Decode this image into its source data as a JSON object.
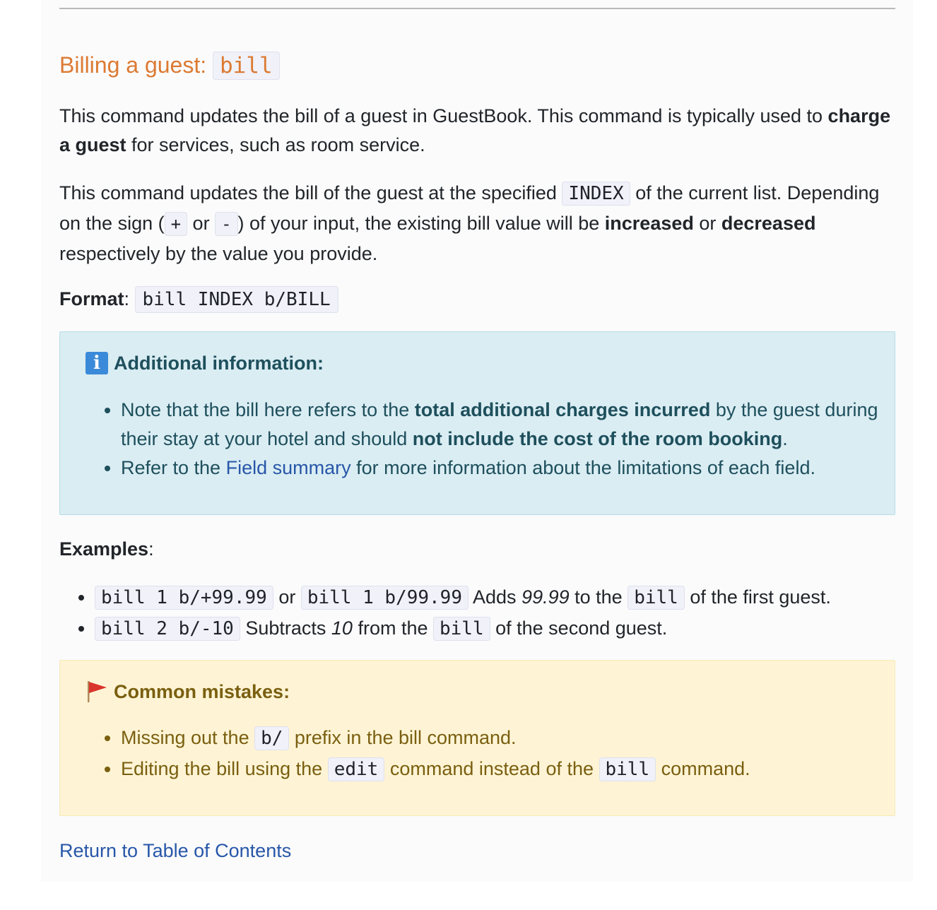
{
  "section": {
    "title_text": "Billing a guest: ",
    "title_code": "bill"
  },
  "intro": {
    "t1": "This command updates the bill of a guest in GuestBook. This command is typically used to ",
    "b1": "charge a guest",
    "t2": " for services, such as room service."
  },
  "details": {
    "t1": "This command updates the bill of the guest at the specified ",
    "c1": "INDEX",
    "t2": " of the current list. Depending on the sign (",
    "c2": "+",
    "t3": " or ",
    "c3": "-",
    "t4": ") of your input, the existing bill value will be ",
    "b1": "increased",
    "t5": " or ",
    "b2": "decreased",
    "t6": " respectively by the value you provide."
  },
  "format": {
    "label": "Format",
    "colon": ": ",
    "code": "bill INDEX b/BILL"
  },
  "info_box": {
    "icon": "info-icon",
    "title": "Additional information:",
    "item1": {
      "t1": "Note that the bill here refers to the ",
      "b1": "total additional charges incurred",
      "t2": " by the guest during their stay at your hotel and should ",
      "b2": "not include the cost of the room booking",
      "t3": "."
    },
    "item2": {
      "t1": "Refer to the ",
      "link": "Field summary",
      "t2": " for more information about the limitations of each field."
    }
  },
  "examples": {
    "label": "Examples",
    "colon": ":",
    "ex1": {
      "c1": "bill 1 b/+99.99",
      "t1": " or ",
      "c2": "bill 1 b/99.99",
      "t2": " Adds ",
      "i1": "99.99",
      "t3": " to the ",
      "c3": "bill",
      "t4": " of the first guest."
    },
    "ex2": {
      "c1": "bill 2 b/-10",
      "t1": " Subtracts ",
      "i1": "10",
      "t2": " from the ",
      "c2": "bill",
      "t3": " of the second guest."
    }
  },
  "warn_box": {
    "icon": "red-flag-icon",
    "title": "Common mistakes:",
    "item1": {
      "t1": "Missing out the ",
      "c1": "b/",
      "t2": " prefix in the bill command."
    },
    "item2": {
      "t1": "Editing the bill using the ",
      "c1": "edit",
      "t2": " command instead of the ",
      "c2": "bill",
      "t3": " command."
    }
  },
  "return_link": "Return to Table of Contents",
  "colors": {
    "heading": "#dc7a32",
    "link": "#2857a8",
    "info_bg": "#daedf3",
    "warn_bg": "#fef4d5",
    "flag": "#d9342b"
  }
}
